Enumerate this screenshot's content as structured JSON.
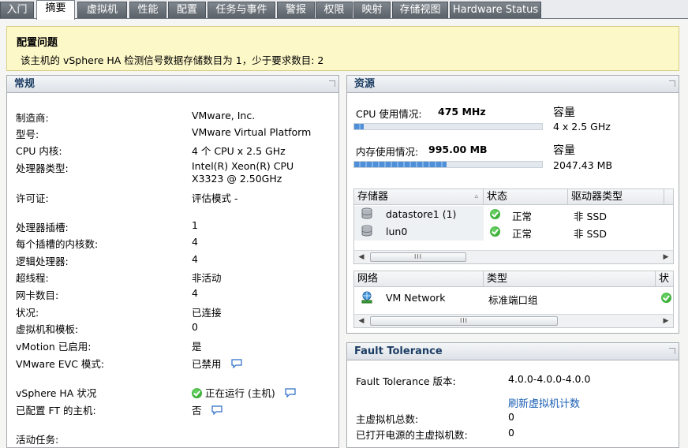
{
  "tabs": [
    {
      "label": "入门"
    },
    {
      "label": "摘要"
    },
    {
      "label": "虚拟机"
    },
    {
      "label": "性能"
    },
    {
      "label": "配置"
    },
    {
      "label": "任务与事件"
    },
    {
      "label": "警报"
    },
    {
      "label": "权限"
    },
    {
      "label": "映射"
    },
    {
      "label": "存储视图"
    },
    {
      "label": "Hardware Status"
    }
  ],
  "active_tab": "摘要",
  "config_issue": {
    "title": "配置问题",
    "message": "该主机的 vSphere HA 检测信号数据存储数目为 1，少于要求数目: 2"
  },
  "general": {
    "title": "常规",
    "rows": [
      {
        "label": "制造商:",
        "value": "VMware, Inc."
      },
      {
        "label": "型号:",
        "value": "VMware Virtual Platform"
      },
      {
        "label": "CPU 内核:",
        "value": "4 个 CPU x 2.5 GHz"
      },
      {
        "label": "处理器类型:",
        "value": "Intel(R) Xeon(R) CPU",
        "value2": "X3323  @ 2.50GHz"
      },
      {
        "label": "许可证:",
        "value": "评估模式 -"
      },
      {
        "label": "处理器插槽:",
        "value": "1"
      },
      {
        "label": "每个插槽的内核数:",
        "value": "4"
      },
      {
        "label": "逻辑处理器:",
        "value": "4"
      },
      {
        "label": "超线程:",
        "value": "非活动"
      },
      {
        "label": "网卡数目:",
        "value": "4"
      },
      {
        "label": "状况:",
        "value": "已连接"
      },
      {
        "label": "虚拟机和模板:",
        "value": "0"
      },
      {
        "label": "vMotion 已启用:",
        "value": "是"
      },
      {
        "label": "VMware EVC 模式:",
        "value": "已禁用"
      },
      {
        "label": "vSphere HA 状况",
        "value": "正在运行 (主机)"
      },
      {
        "label": "已配置 FT 的主机:",
        "value": "否"
      },
      {
        "label": "活动任务:",
        "value": ""
      }
    ]
  },
  "resources": {
    "title": "资源",
    "cpu": {
      "label": "CPU 使用情况:",
      "value": "475 MHz",
      "capacity_label": "容量",
      "capacity": "4 x 2.5 GHz",
      "usage_fraction": 0.05
    },
    "memory": {
      "label": "内存使用情况:",
      "value": "995.00 MB",
      "capacity_label": "容量",
      "capacity": "2047.43 MB",
      "usage_fraction": 0.49
    },
    "storage": {
      "headers": [
        "存储器",
        "状态",
        "驱动器类型"
      ],
      "rows": [
        {
          "name": "datastore1 (1)",
          "status": "正常",
          "drive": "非 SSD"
        },
        {
          "name": "lun0",
          "status": "正常",
          "drive": "非 SSD"
        }
      ]
    },
    "network": {
      "headers": [
        "网络",
        "类型",
        "状"
      ],
      "rows": [
        {
          "name": "VM Network",
          "type": "标准端口组"
        }
      ]
    }
  },
  "fault_tolerance": {
    "title": "Fault Tolerance",
    "version_label": "Fault Tolerance 版本:",
    "version": "4.0.0-4.0.0-4.0.0",
    "refresh_link": "刷新虚拟机计数",
    "primary_total_label": "主虚拟机总数:",
    "primary_total": "0",
    "powered_on_label": "已打开电源的主虚拟机数:",
    "powered_on": "0"
  },
  "colors": {
    "banner_bg": "#fdf8c8",
    "panel_title": "#1c3d63",
    "link": "#1a5fb4",
    "ok": "#1f9a1c"
  }
}
